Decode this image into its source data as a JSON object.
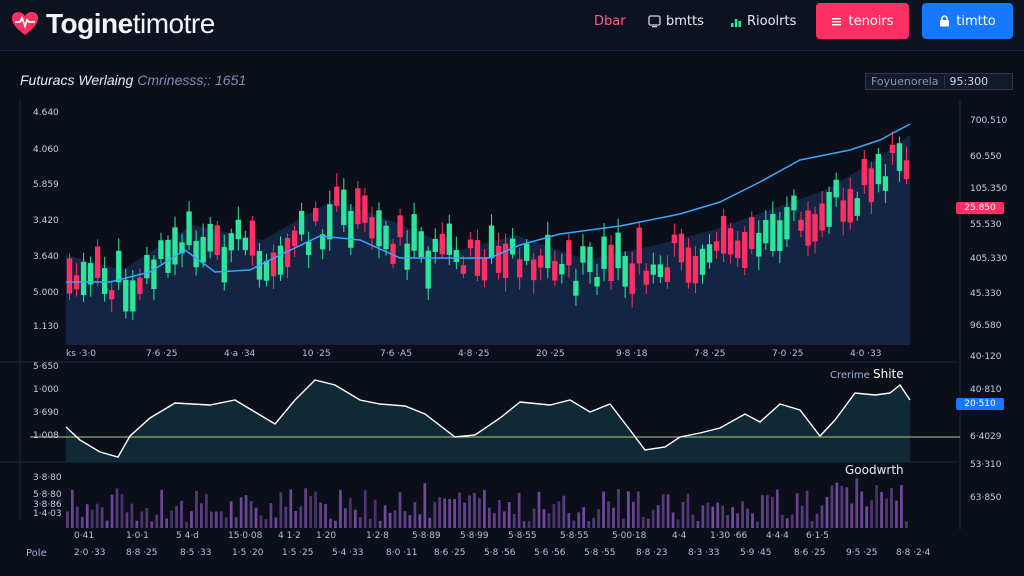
{
  "app": {
    "logo_bold": "Togine",
    "logo_light": "timotre"
  },
  "nav": [
    {
      "label": "Dbar",
      "icon": "none"
    },
    {
      "label": "bmtts",
      "icon": "screen-icon"
    },
    {
      "label": "Rioolrts",
      "icon": "bar-icon"
    }
  ],
  "buttons": {
    "red_label": "tenoirs",
    "blue_label": "timtto"
  },
  "panel": {
    "title": "Futuracs Werlaing",
    "subtitle": "Cmrinesss;: 1651",
    "top_right_label": "Foyuenorela",
    "top_right_value": "95:300"
  },
  "price_axis_left": [
    "4.640",
    "4.060",
    "5.859",
    "3.420",
    "3.640",
    "5.000",
    "1.130"
  ],
  "price_axis_right": [
    "700.510",
    "60.550",
    "105.350",
    "55.530",
    "405.330",
    "45.330",
    "96.580"
  ],
  "price_badge": "25.850",
  "x_ticks_price": [
    "ks ·3·0",
    "7·6 ·25",
    "4·a ·34",
    "10 ·25",
    "7·6 ·A5",
    "4·8 ·25",
    "20 ·25",
    "9·8 ·18",
    "7·8 ·25",
    "7·0 ·25",
    "4·0 ·33"
  ],
  "osc": {
    "label_light": "Crerime",
    "label_bold": "Shite",
    "left_ticks": [
      "5·650",
      "1·000",
      "3·690",
      "1·008"
    ],
    "right_ticks": [
      "40·120",
      "40·810",
      "6·4029"
    ],
    "badge": "20·510"
  },
  "volume": {
    "label": "Goodwrth",
    "left_ticks": [
      "3·8·80",
      "5·8·80",
      "3·8·86",
      "1·4·03"
    ],
    "right_ticks": [
      "53·310",
      "63·850"
    ],
    "x_ticks_row1": [
      "0·41",
      "1·0·1",
      "5 4·d",
      "15·0·08",
      "4 1·2",
      "1·20",
      "1·2·8",
      "5·8·89",
      "5·8·99",
      "5·8·55",
      "5·8·55",
      "5·00·18",
      "4·4",
      "1·30 ·66",
      "4·4·4",
      "6·1·5"
    ],
    "x_ticks_row2": [
      "2·0 ·33",
      "8·8 ·25",
      "8·5 ·33",
      "1·5 ·20",
      "1·5 ·25",
      "5·4 ·33",
      "8·0 ·11",
      "8·6 ·25",
      "5·8 ·56",
      "5·6 ·56",
      "5·8 ·55",
      "8·8 ·23",
      "8·3 ·33",
      "5·9 ·45",
      "8·6 ·25",
      "9·5 ·25",
      "8·8 ·2·4"
    ],
    "bottom_left": "Pole"
  },
  "colors": {
    "background": "#0b0f1a",
    "bull": "#2ee59d",
    "bear": "#ff2e63",
    "ma_line": "#38a8ff",
    "volume": "#7b4fa8",
    "accent_red": "#ff2e63",
    "accent_blue": "#1677ff"
  }
}
